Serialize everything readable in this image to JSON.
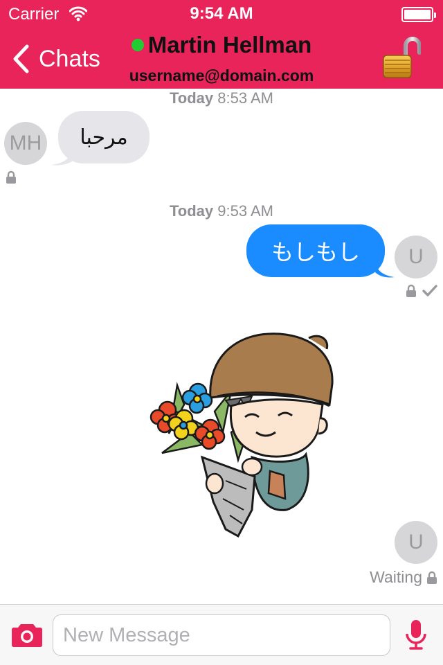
{
  "status_bar": {
    "carrier": "Carrier",
    "time": "9:54 AM"
  },
  "nav": {
    "back_label": "Chats",
    "contact_name": "Martin Hellman",
    "contact_subtitle": "username@domain.com",
    "presence": "online",
    "encryption_icon": "open-padlock-icon"
  },
  "messages": [
    {
      "timestamp_day": "Today",
      "timestamp_time": "8:53 AM",
      "direction": "incoming",
      "avatar": "MH",
      "text": "مرحبا",
      "status_icons": [
        "lock-icon"
      ]
    },
    {
      "timestamp_day": "Today",
      "timestamp_time": "9:53 AM",
      "direction": "outgoing",
      "avatar": "U",
      "text": "もしもし",
      "status_icons": [
        "lock-icon",
        "check-icon"
      ]
    },
    {
      "direction": "outgoing",
      "type": "sticker",
      "sticker": "boy-with-flowers-sticker",
      "avatar": "U",
      "status_text": "Waiting",
      "status_icons": [
        "lock-icon"
      ]
    }
  ],
  "composer": {
    "placeholder": "New Message",
    "value": ""
  },
  "colors": {
    "header": "#e8245a",
    "outgoing_bubble": "#1a8cff",
    "incoming_bubble": "#e5e5ea",
    "online": "#22cc33"
  }
}
